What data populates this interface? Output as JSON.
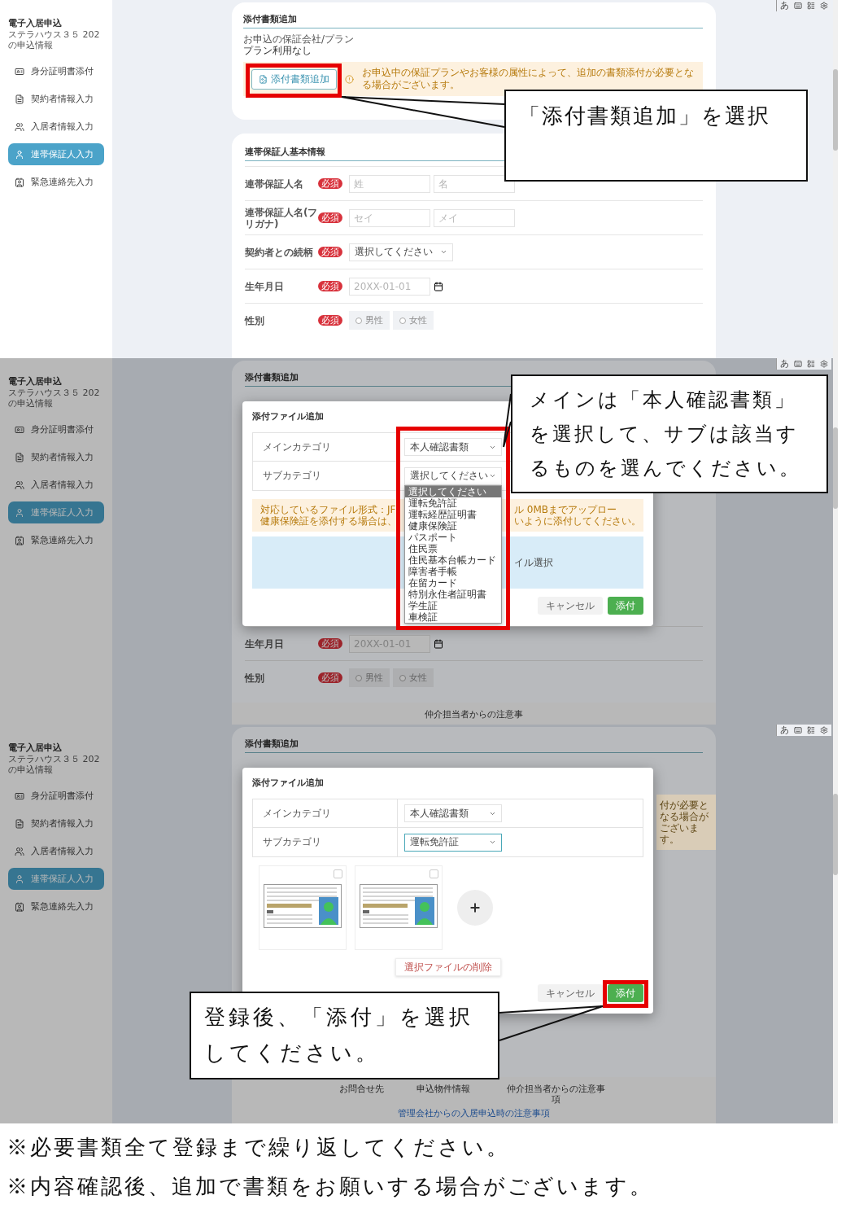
{
  "screens": [
    {
      "kind": "form",
      "sidebar": {
        "title": "電子入居申込",
        "subtitle": "ステラハウス３５ 202の申込情報",
        "items": [
          {
            "label": "身分証明書添付",
            "selected": false
          },
          {
            "label": "契約者情報入力",
            "selected": false
          },
          {
            "label": "入居者情報入力",
            "selected": false
          },
          {
            "label": "連帯保証人入力",
            "selected": true
          },
          {
            "label": "緊急連絡先入力",
            "selected": false
          }
        ]
      },
      "ime": {
        "mode": "あ"
      },
      "attach_section": {
        "title": "添付書類追加",
        "plan_label": "お申込の保証会社/プラン",
        "plan_value": "プラン利用なし",
        "add_button": "添付書類追加",
        "notice": "お申込中の保証プランやお客様の属性によって、追加の書類添付が必要となる場合がございます。"
      },
      "guarantor_section": {
        "title": "連帯保証人基本情報",
        "rows": [
          {
            "kind": "name",
            "label": "連帯保証人名",
            "badge": "必須",
            "placeholders": [
              "姓",
              "名"
            ]
          },
          {
            "kind": "name",
            "label": "連帯保証人名(フリガナ)",
            "badge": "必須",
            "placeholders": [
              "セイ",
              "メイ"
            ]
          },
          {
            "kind": "select",
            "label": "契約者との続柄",
            "badge": "必須",
            "value": "選択してください"
          },
          {
            "kind": "date",
            "label": "生年月日",
            "badge": "必須",
            "placeholder": "20XX-01-01"
          },
          {
            "kind": "radio",
            "label": "性別",
            "badge": "必須",
            "options": [
              {
                "label": "男性",
                "selected": false
              },
              {
                "label": "女性",
                "selected": false
              }
            ]
          }
        ]
      },
      "callout": "「添付書類追加」を選択"
    },
    {
      "kind": "modal",
      "sidebar": {
        "title": "電子入居申込",
        "subtitle": "ステラハウス３５ 202の申込情報",
        "items": [
          {
            "label": "身分証明書添付",
            "selected": false
          },
          {
            "label": "契約者情報入力",
            "selected": false
          },
          {
            "label": "入居者情報入力",
            "selected": false
          },
          {
            "label": "連帯保証人入力",
            "selected": true
          },
          {
            "label": "緊急連絡先入力",
            "selected": false
          }
        ]
      },
      "ime": {
        "mode": "あ"
      },
      "background": {
        "title": "添付書類追加",
        "rows": [
          {
            "kind": "date",
            "label": "生年月日",
            "badge": "必須",
            "placeholder": "20XX-01-01"
          },
          {
            "kind": "radio",
            "label": "性別",
            "badge": "必須",
            "options": [
              {
                "label": "男性",
                "selected": false
              },
              {
                "label": "女性",
                "selected": false
              }
            ]
          }
        ],
        "footer": {
          "items": [
            "仲介担当者からの注意事"
          ]
        }
      },
      "modal": {
        "title": "添付ファイル追加",
        "fields": [
          {
            "label": "メインカテゴリ",
            "value": "本人確認書類",
            "focused": false
          },
          {
            "label": "サブカテゴリ",
            "value": "選択してください",
            "focused": false,
            "options": [
              {
                "label": "選択してください",
                "selected": true
              },
              {
                "label": "運転免許証",
                "selected": false
              },
              {
                "label": "運転経歴証明書",
                "selected": false
              },
              {
                "label": "健康保険証",
                "selected": false
              },
              {
                "label": "パスポート",
                "selected": false
              },
              {
                "label": "住民票",
                "selected": false
              },
              {
                "label": "住民基本台帳カード",
                "selected": false
              },
              {
                "label": "障害者手帳",
                "selected": false
              },
              {
                "label": "在留カード",
                "selected": false
              },
              {
                "label": "特別永住者証明書",
                "selected": false
              },
              {
                "label": "学生証",
                "selected": false
              },
              {
                "label": "車検証",
                "selected": false
              }
            ]
          }
        ],
        "notice": [
          {
            "left": "対応しているファイル形式：JF",
            "right": "ル 0MBまでアップロー"
          },
          {
            "left": "健康保険証を添付する場合は、",
            "right": "いように添付してください。"
          }
        ],
        "dropzone": "イル選択",
        "buttons": [
          {
            "kind": "secondary",
            "label": "キャンセル"
          },
          {
            "kind": "primary",
            "label": "添付"
          }
        ]
      },
      "callout": "メインは「本人確認書類」を選択して、サブは該当するものを選んでください。"
    },
    {
      "kind": "modal",
      "sidebar": {
        "title": "電子入居申込",
        "subtitle": "ステラハウス３５ 202の申込情報",
        "items": [
          {
            "label": "身分証明書添付",
            "selected": false
          },
          {
            "label": "契約者情報入力",
            "selected": false
          },
          {
            "label": "入居者情報入力",
            "selected": false
          },
          {
            "label": "連帯保証人入力",
            "selected": true
          },
          {
            "label": "緊急連絡先入力",
            "selected": false
          }
        ]
      },
      "ime": {
        "mode": "あ"
      },
      "background": {
        "title": "添付書類追加",
        "notice_fragment": "付が必要となる場合がございます。",
        "footer": {
          "items": [
            "お問合せ先",
            "申込物件情報",
            "仲介担当者からの注意事項"
          ],
          "link": "管理会社からの入居申込時の注意事項"
        }
      },
      "modal": {
        "title": "添付ファイル追加",
        "fields": [
          {
            "label": "メインカテゴリ",
            "value": "本人確認書類",
            "focused": false
          },
          {
            "label": "サブカテゴリ",
            "value": "運転免許証",
            "focused": true
          }
        ],
        "files": [
          {
            "checked": false
          },
          {
            "checked": false
          }
        ],
        "delete_button": "選択ファイルの削除",
        "buttons": [
          {
            "kind": "secondary",
            "label": "キャンセル"
          },
          {
            "kind": "primary",
            "label": "添付"
          }
        ]
      },
      "callout": "登録後、「添付」を選択してください。"
    }
  ],
  "notes": [
    "※必要書類全て登録まで繰り返してください。",
    "※内容確認後、追加で書類をお願いする場合がございます。"
  ]
}
